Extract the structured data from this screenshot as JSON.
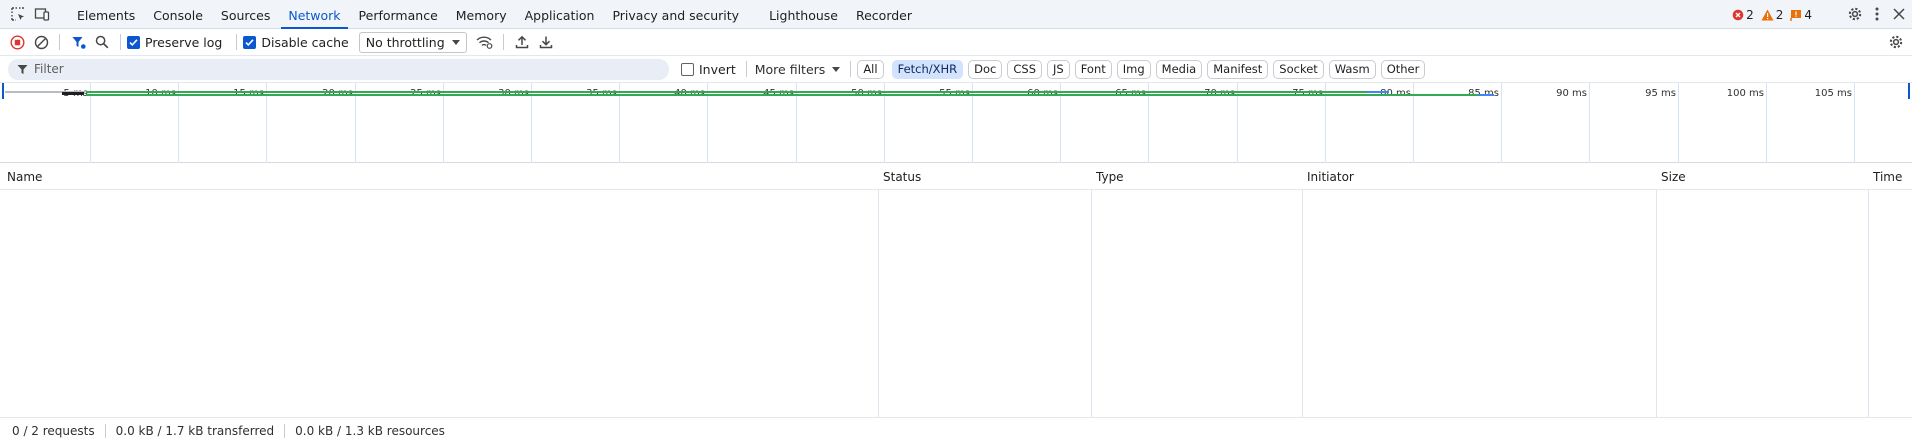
{
  "tabs": [
    {
      "label": "Elements"
    },
    {
      "label": "Console"
    },
    {
      "label": "Sources"
    },
    {
      "label": "Network",
      "active": true
    },
    {
      "label": "Performance"
    },
    {
      "label": "Memory"
    },
    {
      "label": "Application"
    },
    {
      "label": "Privacy and security"
    },
    {
      "label": "Lighthouse"
    },
    {
      "label": "Recorder"
    }
  ],
  "badges": {
    "errors": "2",
    "warnings": "2",
    "issues": "4"
  },
  "toolbar": {
    "preserve_log": "Preserve log",
    "preserve_log_checked": true,
    "disable_cache": "Disable cache",
    "disable_cache_checked": true,
    "throttling": "No throttling"
  },
  "filter": {
    "placeholder": "Filter",
    "invert": "Invert",
    "more_filters": "More filters",
    "types": [
      "All",
      "Fetch/XHR",
      "Doc",
      "CSS",
      "JS",
      "Font",
      "Img",
      "Media",
      "Manifest",
      "Socket",
      "Wasm",
      "Other"
    ],
    "active_type": "Fetch/XHR"
  },
  "overview": {
    "ticks": [
      "5 ms",
      "10 ms",
      "15 ms",
      "20 ms",
      "25 ms",
      "30 ms",
      "35 ms",
      "40 ms",
      "45 ms",
      "50 ms",
      "55 ms",
      "60 ms",
      "65 ms",
      "70 ms",
      "75 ms",
      "80 ms",
      "85 ms",
      "90 ms",
      "95 ms",
      "100 ms",
      "105 ms"
    ]
  },
  "columns": [
    "Name",
    "Status",
    "Type",
    "Initiator",
    "Size",
    "Time"
  ],
  "status_bar": {
    "requests": "0 / 2 requests",
    "transferred": "0.0 kB / 1.7 kB transferred",
    "resources": "0.0 kB / 1.3 kB resources"
  },
  "colors": {
    "accent": "#0b57d0",
    "error": "#dc362e",
    "warning": "#e8710a",
    "record": "#dc362e"
  }
}
